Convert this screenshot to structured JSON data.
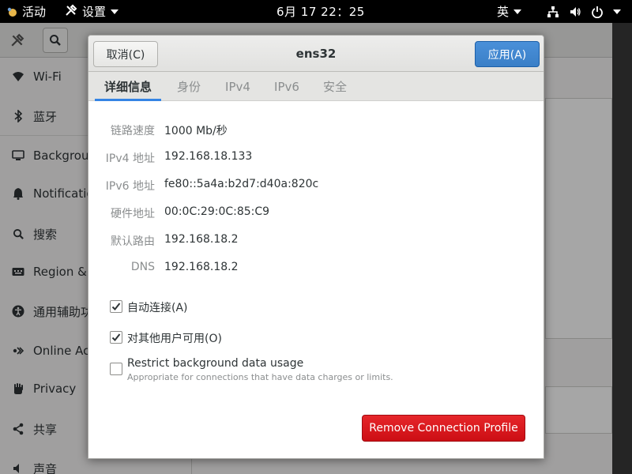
{
  "topbar": {
    "activities": "活动",
    "app_menu": "设置",
    "clock": "6月 17  22：25",
    "input_method": "英"
  },
  "sidebar": {
    "items": [
      {
        "label": "Wi-Fi",
        "icon": "wifi-icon"
      },
      {
        "label": "蓝牙",
        "icon": "bluetooth-icon"
      },
      {
        "label": "Background",
        "icon": "display-icon"
      },
      {
        "label": "Notifications",
        "icon": "bell-icon"
      },
      {
        "label": "搜索",
        "icon": "search-icon"
      },
      {
        "label": "Region & Language",
        "icon": "keyboard-icon"
      },
      {
        "label": "通用辅助功能",
        "icon": "accessibility-icon"
      },
      {
        "label": "Online Accounts",
        "icon": "share-icon"
      },
      {
        "label": "Privacy",
        "icon": "hand-icon"
      },
      {
        "label": "共享",
        "icon": "share-icon"
      },
      {
        "label": "声音",
        "icon": "speaker-icon"
      }
    ]
  },
  "dialog": {
    "title": "ens32",
    "cancel_label": "取消(C)",
    "apply_label": "应用(A)",
    "tabs": [
      "详细信息",
      "身份",
      "IPv4",
      "IPv6",
      "安全"
    ],
    "details": [
      {
        "label": "链路速度",
        "value": "1000 Mb/秒"
      },
      {
        "label": "IPv4 地址",
        "value": "192.168.18.133"
      },
      {
        "label": "IPv6 地址",
        "value": "fe80::5a4a:b2d7:d40a:820c"
      },
      {
        "label": "硬件地址",
        "value": "00:0C:29:0C:85:C9"
      },
      {
        "label": "默认路由",
        "value": "192.168.18.2"
      },
      {
        "label": "DNS",
        "value": "192.168.18.2"
      }
    ],
    "auto_connect": {
      "label": "自动连接(A)",
      "checked": true
    },
    "all_users": {
      "label": "对其他用户可用(O)",
      "checked": true
    },
    "restrict": {
      "label": "Restrict background data usage",
      "sub": "Appropriate for connections that have data charges or limits.",
      "checked": false
    },
    "remove_label": "Remove Connection Profile"
  },
  "colors": {
    "accent": "#3584e4",
    "apply": "#3a7fc7",
    "destructive": "#cc0e14"
  }
}
